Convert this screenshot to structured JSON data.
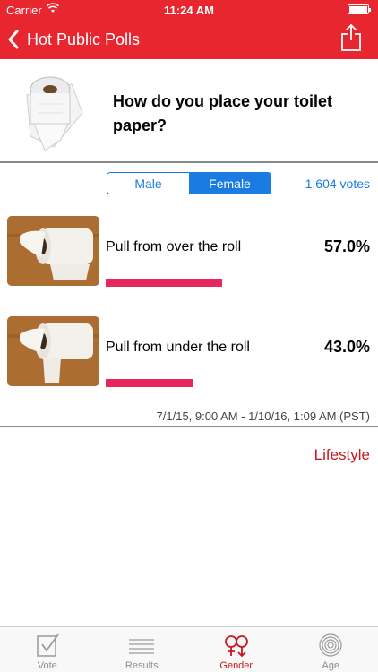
{
  "status_bar": {
    "carrier": "Carrier",
    "time": "11:24 AM"
  },
  "nav": {
    "back_label": "Hot Public Polls",
    "icons": [
      "chevron-left-icon",
      "share-icon"
    ]
  },
  "poll": {
    "question": "How do you place your toilet paper?",
    "image": "toilet-paper-roll-image",
    "votes": "1,604 votes",
    "date_range": "7/1/15, 9:00 AM - 1/10/16, 1:09 AM (PST)",
    "category": "Lifestyle"
  },
  "segments": {
    "items": [
      {
        "label": "Male",
        "selected": false
      },
      {
        "label": "Female",
        "selected": true
      }
    ]
  },
  "answers": [
    {
      "label": "Pull from over the roll",
      "percent": "57.0%",
      "value": 57.0
    },
    {
      "label": "Pull from under the roll",
      "percent": "43.0%",
      "value": 43.0
    }
  ],
  "tabbar": {
    "items": [
      {
        "label": "Vote",
        "icon": "vote-checkbox-icon",
        "active": false
      },
      {
        "label": "Results",
        "icon": "results-list-icon",
        "active": false
      },
      {
        "label": "Gender",
        "icon": "gender-icon",
        "active": true
      },
      {
        "label": "Age",
        "icon": "age-rings-icon",
        "active": false
      }
    ]
  },
  "colors": {
    "brand_red": "#e8262f",
    "accent_blue": "#1a7be3",
    "bar_pink": "#e8265e",
    "category_red": "#c9161e"
  }
}
